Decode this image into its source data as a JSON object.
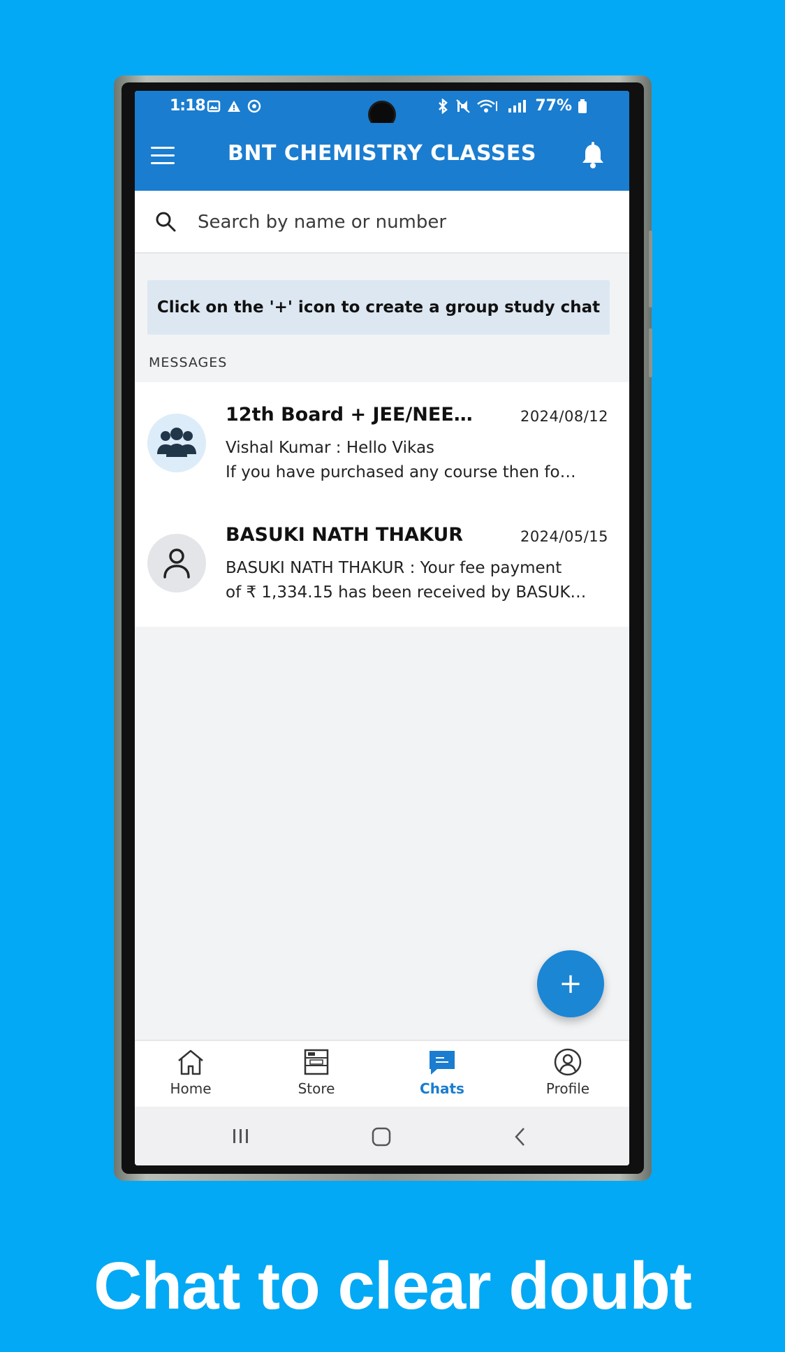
{
  "status_bar": {
    "time": "1:18",
    "battery": "77%"
  },
  "app_bar": {
    "title": "BNT CHEMISTRY CLASSES"
  },
  "search": {
    "placeholder": "Search by name or number"
  },
  "hint": {
    "text": "Click on the '+' icon to create a group study chat"
  },
  "messages": {
    "section_label": "MESSAGES",
    "items": [
      {
        "name": "12th Board + JEE/NEE…",
        "date": "2024/08/12",
        "line1": "Vishal Kumar :  Hello Vikas",
        "line2": "If you have purchased any course then fo…",
        "avatar": "group-icon"
      },
      {
        "name": "BASUKI NATH THAKUR",
        "date": "2024/05/15",
        "line1": "BASUKI NATH THAKUR :  Your fee payment",
        "line2": "of ₹ 1,334.15 has been received by BASUK…",
        "avatar": "person-icon"
      }
    ]
  },
  "fab": {
    "label": "+"
  },
  "bottom_nav": {
    "items": [
      {
        "label": "Home",
        "icon": "home-icon"
      },
      {
        "label": "Store",
        "icon": "store-icon"
      },
      {
        "label": "Chats",
        "icon": "chat-icon",
        "active": true
      },
      {
        "label": "Profile",
        "icon": "profile-icon"
      }
    ]
  },
  "caption": "Chat to clear doubt",
  "colors": {
    "background": "#03a9f4",
    "app_bar": "#1a7dd0",
    "accent": "#1b86d4"
  }
}
